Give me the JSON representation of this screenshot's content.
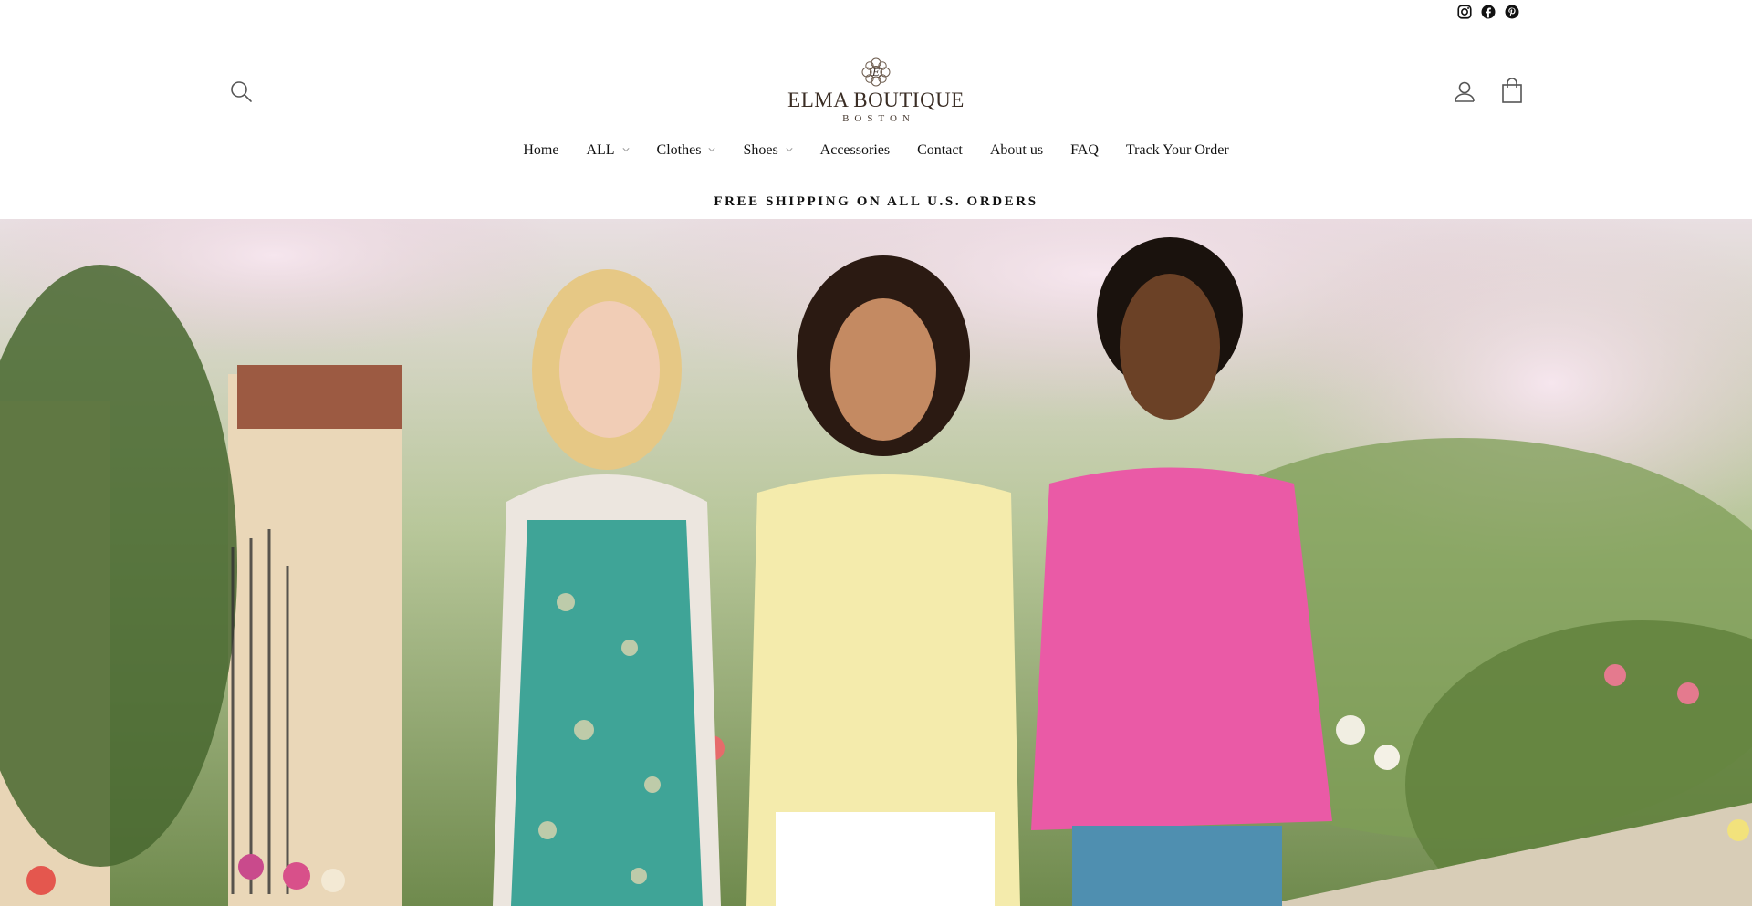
{
  "social": {
    "icons": [
      "instagram-icon",
      "facebook-icon",
      "pinterest-icon"
    ]
  },
  "header": {
    "logo": {
      "name": "ELMA BOUTIQUE",
      "city": "BOSTON"
    },
    "icons": {
      "search": "search-icon",
      "account": "user-icon",
      "cart": "shopping-bag-icon"
    }
  },
  "nav": {
    "items": [
      {
        "label": "Home",
        "dropdown": false
      },
      {
        "label": "ALL",
        "dropdown": true
      },
      {
        "label": "Clothes",
        "dropdown": true
      },
      {
        "label": "Shoes",
        "dropdown": true
      },
      {
        "label": "Accessories",
        "dropdown": false
      },
      {
        "label": "Contact",
        "dropdown": false
      },
      {
        "label": "About us",
        "dropdown": false
      },
      {
        "label": "FAQ",
        "dropdown": false
      },
      {
        "label": "Track Your Order",
        "dropdown": false
      }
    ]
  },
  "announcement": {
    "text": "FREE SHIPPING ON ALL U.S. ORDERS"
  },
  "colors": {
    "text": "#111111",
    "logo": "#3a2d24",
    "border": "#222222",
    "background": "#ffffff"
  }
}
